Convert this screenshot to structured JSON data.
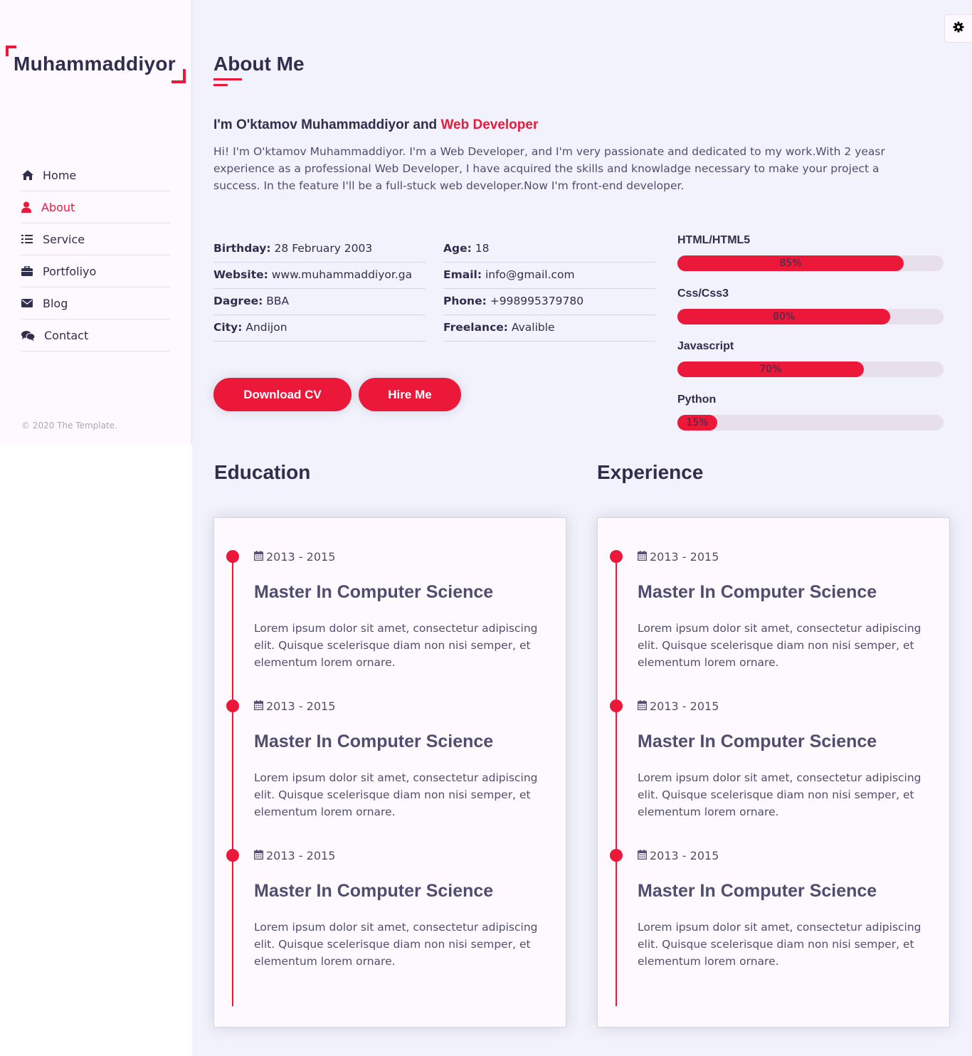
{
  "sidebar": {
    "logo": "Muhammaddiyor",
    "nav": [
      {
        "label": "Home",
        "icon": "home-icon",
        "active": false
      },
      {
        "label": "About",
        "icon": "user-icon",
        "active": true
      },
      {
        "label": "Service",
        "icon": "list-icon",
        "active": false
      },
      {
        "label": "Portfoliyo",
        "icon": "briefcase-icon",
        "active": false
      },
      {
        "label": "Blog",
        "icon": "envelope-icon",
        "active": false
      },
      {
        "label": "Contact",
        "icon": "comments-icon",
        "active": false
      }
    ],
    "copyright": "© 2020 The Template."
  },
  "settings": {
    "icon": "gear-icon"
  },
  "about": {
    "title": "About Me",
    "heading_prefix": "I'm O'ktamov Muhammaddiyor and ",
    "heading_accent": "Web Developer",
    "intro": "Hi! I'm O'ktamov Muhammaddiyor. I'm a Web Developer, and I'm very passionate and dedicated to my work.With 2 yeasr experience as a professional Web Developer, I have acquired the skills and knowladge necessary to make your project a success. In the feature I'll be a full-stuck web developer.Now I'm front-end developer.",
    "info_left": [
      {
        "label": "Birthday:",
        "value": "28 February 2003"
      },
      {
        "label": "Website:",
        "value": "www.muhammaddiyor.ga"
      },
      {
        "label": "Dagree:",
        "value": "BBA"
      },
      {
        "label": "City:",
        "value": "Andijon"
      }
    ],
    "info_right": [
      {
        "label": "Age:",
        "value": "18"
      },
      {
        "label": "Email:",
        "value": "info@gmail.com"
      },
      {
        "label": "Phone:",
        "value": "+998995379780"
      },
      {
        "label": "Freelance:",
        "value": "Avalible"
      }
    ],
    "buttons": {
      "download": "Download CV",
      "hire": "Hire Me"
    },
    "skills": [
      {
        "name": "HTML/HTML5",
        "percent": 85,
        "label": "85%"
      },
      {
        "name": "Css/Css3",
        "percent": 80,
        "label": "80%"
      },
      {
        "name": "Javascript",
        "percent": 70,
        "label": "70%"
      },
      {
        "name": "Python",
        "percent": 15,
        "label": "15%"
      }
    ]
  },
  "education": {
    "title": "Education",
    "items": [
      {
        "date": "2013 - 2015",
        "title": "Master In Computer Science",
        "text": "Lorem ipsum dolor sit amet, consectetur adipiscing elit. Quisque scelerisque diam non nisi semper, et elementum lorem ornare."
      },
      {
        "date": "2013 - 2015",
        "title": "Master In Computer Science",
        "text": "Lorem ipsum dolor sit amet, consectetur adipiscing elit. Quisque scelerisque diam non nisi semper, et elementum lorem ornare."
      },
      {
        "date": "2013 - 2015",
        "title": "Master In Computer Science",
        "text": "Lorem ipsum dolor sit amet, consectetur adipiscing elit. Quisque scelerisque diam non nisi semper, et elementum lorem ornare."
      }
    ]
  },
  "experience": {
    "title": "Experience",
    "items": [
      {
        "date": "2013 - 2015",
        "title": "Master In Computer Science",
        "text": "Lorem ipsum dolor sit amet, consectetur adipiscing elit. Quisque scelerisque diam non nisi semper, et elementum lorem ornare."
      },
      {
        "date": "2013 - 2015",
        "title": "Master In Computer Science",
        "text": "Lorem ipsum dolor sit amet, consectetur adipiscing elit. Quisque scelerisque diam non nisi semper, et elementum lorem ornare."
      },
      {
        "date": "2013 - 2015",
        "title": "Master In Computer Science",
        "text": "Lorem ipsum dolor sit amet, consectetur adipiscing elit. Quisque scelerisque diam non nisi semper, et elementum lorem ornare."
      }
    ]
  },
  "colors": {
    "accent": "#ec1839",
    "text": "#302e4d",
    "muted": "#504e70",
    "bg": "#f2f2fc",
    "sidebar": "#fdf9ff"
  }
}
